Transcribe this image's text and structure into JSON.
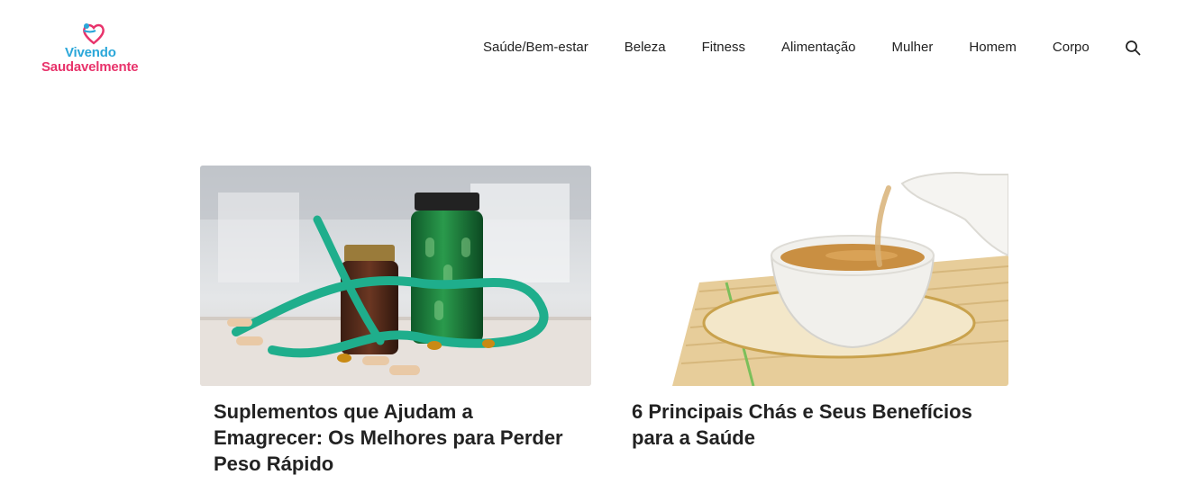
{
  "brand": {
    "line1": "Vivendo",
    "line2": "Saudavelmente",
    "color_primary": "#2aa7d9",
    "color_secondary": "#e8336b"
  },
  "nav": {
    "items": [
      {
        "label": "Saúde/Bem-estar"
      },
      {
        "label": "Beleza"
      },
      {
        "label": "Fitness"
      },
      {
        "label": "Alimentação"
      },
      {
        "label": "Mulher"
      },
      {
        "label": "Homem"
      },
      {
        "label": "Corpo"
      }
    ],
    "search_icon": "search-icon"
  },
  "posts": [
    {
      "title": "Suplementos que Ajudam a Emagrecer: Os Melhores para Perder Peso Rápido",
      "image": "supplements-bottles-measuring-tape"
    },
    {
      "title": "6 Principais Chás e Seus Benefícios para a Saúde",
      "image": "tea-being-poured-into-cup"
    }
  ]
}
